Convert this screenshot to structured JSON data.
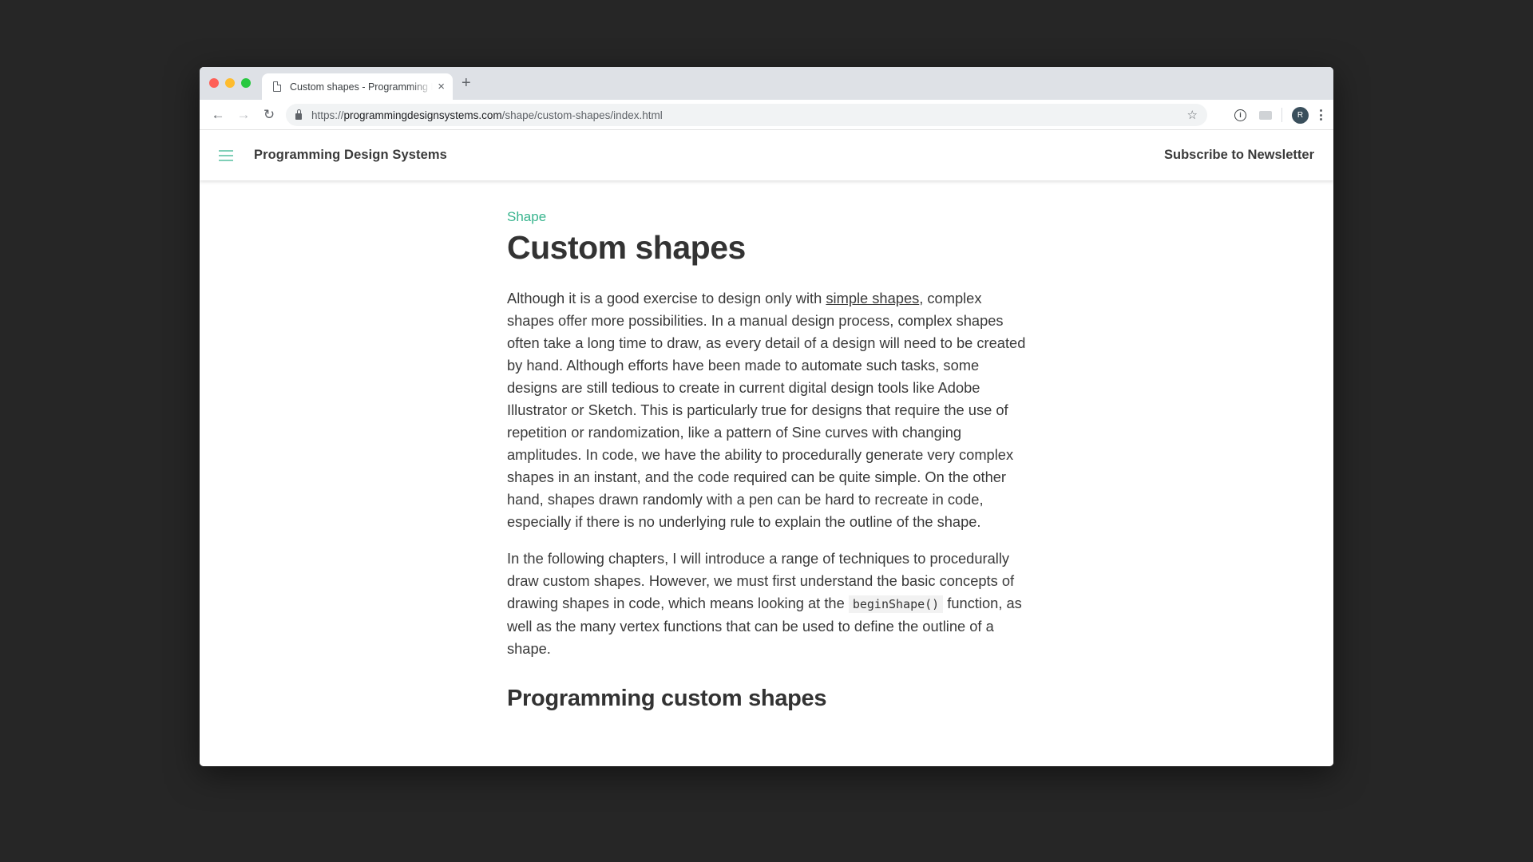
{
  "browser": {
    "tab": {
      "title": "Custom shapes - Programming Design Systems",
      "close_icon": "×"
    },
    "new_tab_icon": "+",
    "address": {
      "scheme": "https://",
      "host": "programmingdesignsystems.com",
      "path": "/shape/custom-shapes/index.html"
    },
    "nav": {
      "back_icon": "←",
      "forward_icon": "→",
      "reload_icon": "↻"
    },
    "star_icon": "☆",
    "info_icon": "i",
    "avatar_initial": "R"
  },
  "site": {
    "title": "Programming Design Systems",
    "subscribe_label": "Subscribe to Newsletter",
    "accent_color": "#38b48e"
  },
  "article": {
    "breadcrumb": "Shape",
    "title": "Custom shapes",
    "p1_before_link": "Although it is a good exercise to design only with ",
    "p1_link": "simple shapes",
    "p1_after_link": ", complex shapes offer more possibilities. In a manual design process, complex shapes often take a long time to draw, as every detail of a design will need to be created by hand. Although efforts have been made to automate such tasks, some designs are still tedious to create in current digital design tools like Adobe Illustrator or Sketch. This is particularly true for designs that require the use of repetition or randomization, like a pattern of Sine curves with changing amplitudes. In code, we have the ability to procedurally generate very complex shapes in an instant, and the code required can be quite simple. On the other hand, shapes drawn randomly with a pen can be hard to recreate in code, especially if there is no underlying rule to explain the outline of the shape.",
    "p2_before_code": "In the following chapters, I will introduce a range of techniques to procedurally draw custom shapes. However, we must first understand the basic concepts of drawing shapes in code, which means looking at the ",
    "p2_code": "beginShape()",
    "p2_after_code": " function, as well as the many vertex functions that can be used to define the outline of a shape.",
    "h2": "Programming custom shapes"
  }
}
